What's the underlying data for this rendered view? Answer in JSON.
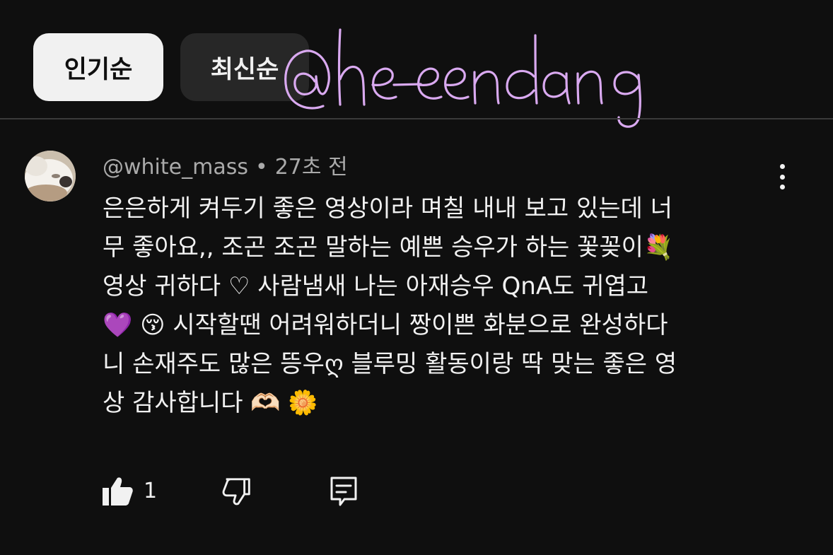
{
  "sort_chips": {
    "popular": "인기순",
    "newest": "최신순"
  },
  "watermark": {
    "text": "@heeendang",
    "color": "#d9a9f0"
  },
  "comment": {
    "author": "@white_mass",
    "separator": "•",
    "time": "27초 전",
    "lines": [
      "은은하게 켜두기 좋은 영상이라 며칠 내내 보고 있는데 너",
      "무 좋아요,, 조곤 조곤 말하는 예쁜 승우가 하는 꽃꽂이💐",
      "영상 귀하다 ♡ 사람냄새 나는 아재승우 QnA도 귀엽고",
      "💜 😚  시작할땐 어려워하더니 짱이쁜 화분으로 완성하다",
      "니 손재주도 많은 뜽우ღ 블루밍 활동이랑 딱 맞는 좋은 영",
      "상 감사합니다 🫶🏻 🌼"
    ],
    "like_count": "1"
  },
  "icons": {
    "avatar": "avatar-dog-photo",
    "more": "more-vertical-icon",
    "like": "thumbs-up-filled-icon",
    "dislike": "thumbs-down-outline-icon",
    "reply": "reply-comment-icon"
  },
  "colors": {
    "background": "#0f0f0f",
    "text": "#f1f1f1",
    "meta_text": "#aaaaaa",
    "chip_active_bg": "#f1f1f1",
    "chip_inactive_bg": "#272727"
  }
}
